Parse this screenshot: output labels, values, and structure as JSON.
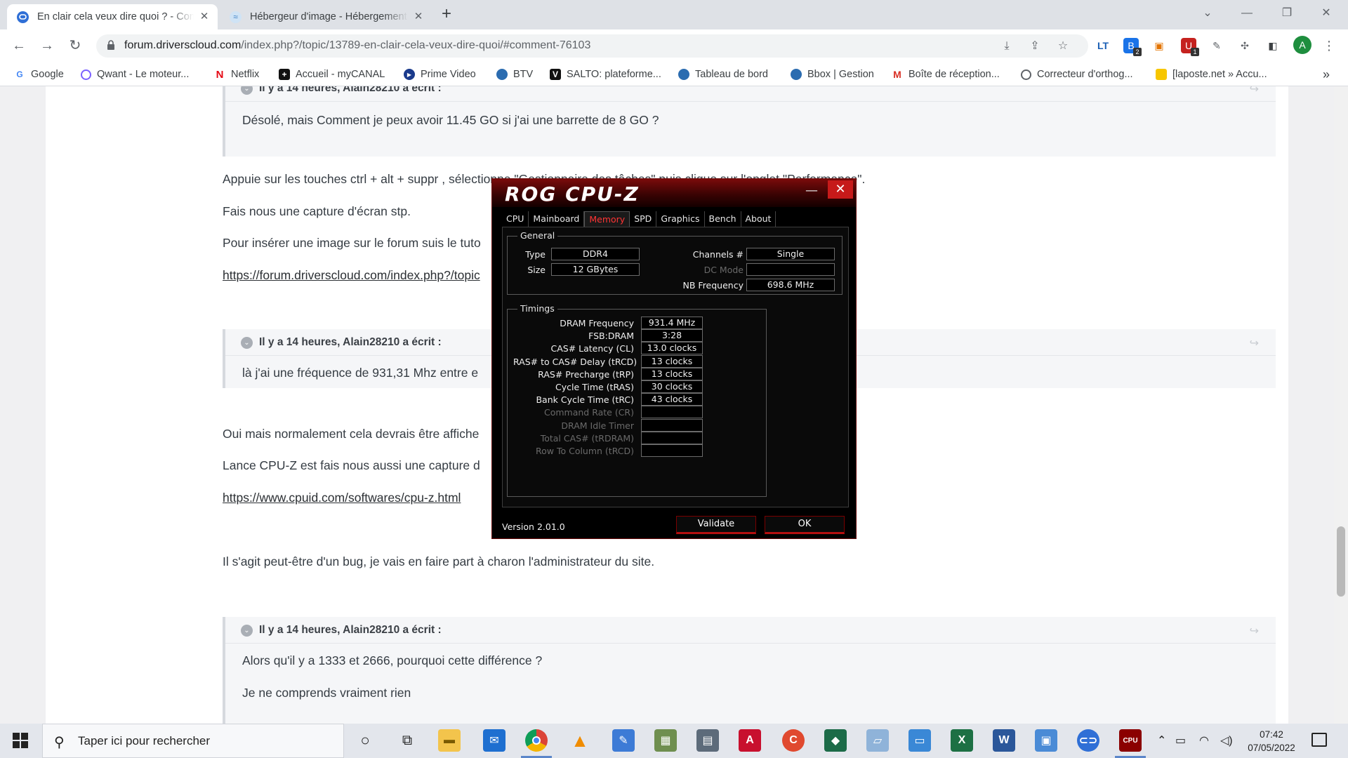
{
  "browser": {
    "tabs": [
      {
        "title": "En clair cela veux dire quoi ? - Communauté DriversCloud",
        "active": true
      },
      {
        "title": "Hébergeur d'image - Hébergement gratuit",
        "active": false
      }
    ],
    "url_host": "forum.driverscloud.com",
    "url_path": "/index.php?/topic/13789-en-clair-cela-veux-dire-quoi/#comment-76103",
    "profile_initial": "A",
    "ext_badge_1": "2",
    "ext_badge_2": "1",
    "bookmarks": [
      "Google",
      "Qwant - Le moteur...",
      "Netflix",
      "Accueil - myCANAL",
      "Prime Video",
      "BTV",
      "SALTO: plateforme...",
      "Tableau de bord",
      "Bbox | Gestion",
      "Boîte de réception...",
      "Correcteur d'orthog...",
      "[laposte.net » Accu..."
    ],
    "more_bookmarks": "»"
  },
  "forum": {
    "quote1_head": "Il y a 14 heures, Alain28210 a écrit :",
    "quote1_body": "Désolé, mais Comment je peux avoir 11.45 GO si j'ai une barrette de 8 GO  ?",
    "p1": "Appuie sur les touches ctrl + alt + suppr , sélectionne \"Gestionnaire des tâches\" puis clique sur l'onglet \"Performance\".",
    "p2": "Fais nous une capture d'écran stp.",
    "p3": "Pour insérer une image sur le forum suis le tuto",
    "p4_link": "https://forum.driverscloud.com/index.php?/topic",
    "quote2_head": "Il y a 14 heures, Alain28210 a écrit :",
    "quote2_body": "là j'ai une fréquence de 931,31 Mhz  entre e",
    "p5": "Oui mais normalement cela devrais être affiche",
    "p6": "Lance CPU-Z est fais nous aussi une capture d",
    "p7_link": "https://www.cpuid.com/softwares/cpu-z.html",
    "p8": "Il s'agit peut-être d'un bug, je vais en faire part à charon l'administrateur du site.",
    "quote3_head": "Il y a 14 heures, Alain28210 a écrit :",
    "quote3_body1": "Alors qu'il y a 1333 et 2666, pourquoi cette différence ?",
    "quote3_body2": "Je ne comprends vraiment rien"
  },
  "cpuz": {
    "brand": "ROG CPU-Z",
    "tabs": [
      "CPU",
      "Mainboard",
      "Memory",
      "SPD",
      "Graphics",
      "Bench",
      "About"
    ],
    "active_tab": "Memory",
    "general_title": "General",
    "general": {
      "type_label": "Type",
      "type_value": "DDR4",
      "size_label": "Size",
      "size_value": "12 GBytes",
      "channels_label": "Channels #",
      "channels_value": "Single",
      "dcmode_label": "DC Mode",
      "dcmode_value": "",
      "nbfreq_label": "NB Frequency",
      "nbfreq_value": "698.6 MHz"
    },
    "timings_title": "Timings",
    "timings": [
      {
        "label": "DRAM Frequency",
        "value": "931.4 MHz",
        "dim": false
      },
      {
        "label": "FSB:DRAM",
        "value": "3:28",
        "dim": false
      },
      {
        "label": "CAS# Latency (CL)",
        "value": "13.0 clocks",
        "dim": false
      },
      {
        "label": "RAS# to CAS# Delay (tRCD)",
        "value": "13 clocks",
        "dim": false
      },
      {
        "label": "RAS# Precharge (tRP)",
        "value": "13 clocks",
        "dim": false
      },
      {
        "label": "Cycle Time (tRAS)",
        "value": "30 clocks",
        "dim": false
      },
      {
        "label": "Bank Cycle Time (tRC)",
        "value": "43 clocks",
        "dim": false
      },
      {
        "label": "Command Rate (CR)",
        "value": "",
        "dim": true
      },
      {
        "label": "DRAM Idle Timer",
        "value": "",
        "dim": true
      },
      {
        "label": "Total CAS# (tRDRAM)",
        "value": "",
        "dim": true
      },
      {
        "label": "Row To Column (tRCD)",
        "value": "",
        "dim": true
      }
    ],
    "version": "Version 2.01.0",
    "validate_label": "Validate",
    "ok_label": "OK"
  },
  "taskbar": {
    "search_placeholder": "Taper ici pour rechercher",
    "time": "07:42",
    "date": "07/05/2022"
  }
}
